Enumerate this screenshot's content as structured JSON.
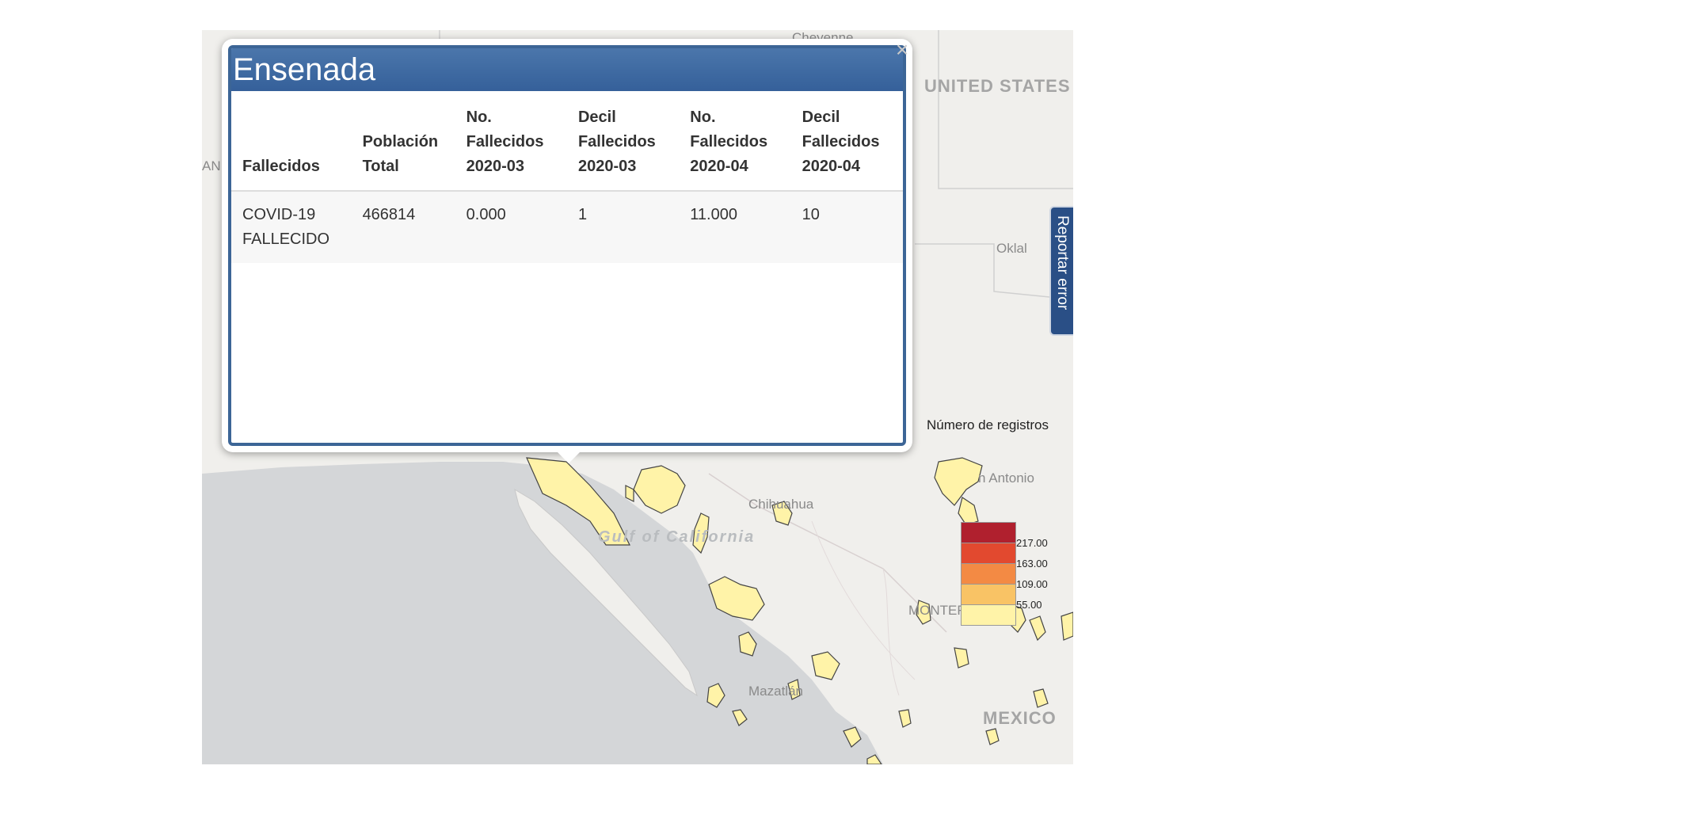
{
  "popup": {
    "title": "Ensenada",
    "close_label": "×",
    "headers": [
      "Fallecidos",
      "Población Total",
      "No. Fallecidos 2020-03",
      "Decil Fallecidos 2020-03",
      "No. Fallecidos 2020-04",
      "Decil Fallecidos 2020-04"
    ],
    "row": [
      "COVID-19 FALLECIDO",
      "466814",
      "0.000",
      "1",
      "11.000",
      "10"
    ]
  },
  "map": {
    "labels": {
      "united_states": "UNITED STATES",
      "mexico": "MEXICO",
      "monterrey": "MONTEF",
      "chihuahua": "Chihuahua",
      "mazatlan": "Mazatlán",
      "san_antonio": "n Antonio",
      "oklahoma": "Oklal",
      "cheyenne": "Cheyenne",
      "gulf": "Gulf of California",
      "left_edge": "AN"
    },
    "report_tab": "Reportar error",
    "legend": {
      "title": "Número de registros",
      "items": [
        {
          "label": "217.00",
          "color": "#b0202e"
        },
        {
          "label": "163.00",
          "color": "#e2492f"
        },
        {
          "label": "109.00",
          "color": "#f38a44"
        },
        {
          "label": "55.00",
          "color": "#f9c365"
        },
        {
          "label": "",
          "color": "#fff3a8"
        }
      ]
    }
  },
  "colors": {
    "popup_header": "#3c6596",
    "water": "#d4d6d8",
    "land": "#f0efec",
    "polygon_fill": "#fff3a8",
    "polygon_stroke": "#444444",
    "report_tab": "#2a4f86"
  }
}
